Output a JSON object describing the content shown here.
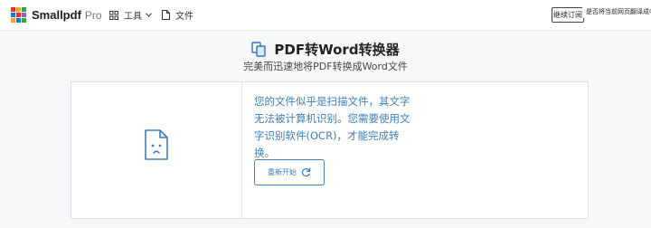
{
  "header": {
    "brand": "Smallpdf",
    "brand_suffix": "Pro",
    "nav": [
      {
        "label": "工具",
        "icon": "grid-icon"
      },
      {
        "label": "文件",
        "icon": "document-icon"
      }
    ],
    "translate_button": "继续订阅",
    "translate_prompt": "是否将当前网页翻译成中文"
  },
  "page": {
    "title": "PDF转Word转换器",
    "subtitle": "完美而迅速地将PDF转换成Word文件"
  },
  "result": {
    "message": "您的文件似乎是扫描文件，其文字无法被计算机识别。您需要使用文字识别软件(OCR)，才能完成转换。",
    "restart_label": "重新开始",
    "restart_icon": "refresh-icon",
    "file_icon": "sad-document-icon"
  },
  "colors": {
    "accent": "#3d7fb8",
    "logo": [
      "#e5322d",
      "#f7a823",
      "#2ea44f",
      "#1f74d0",
      "#e5322d",
      "#9b59b6",
      "#f7a823",
      "#1f74d0",
      "#2ea44f"
    ]
  }
}
